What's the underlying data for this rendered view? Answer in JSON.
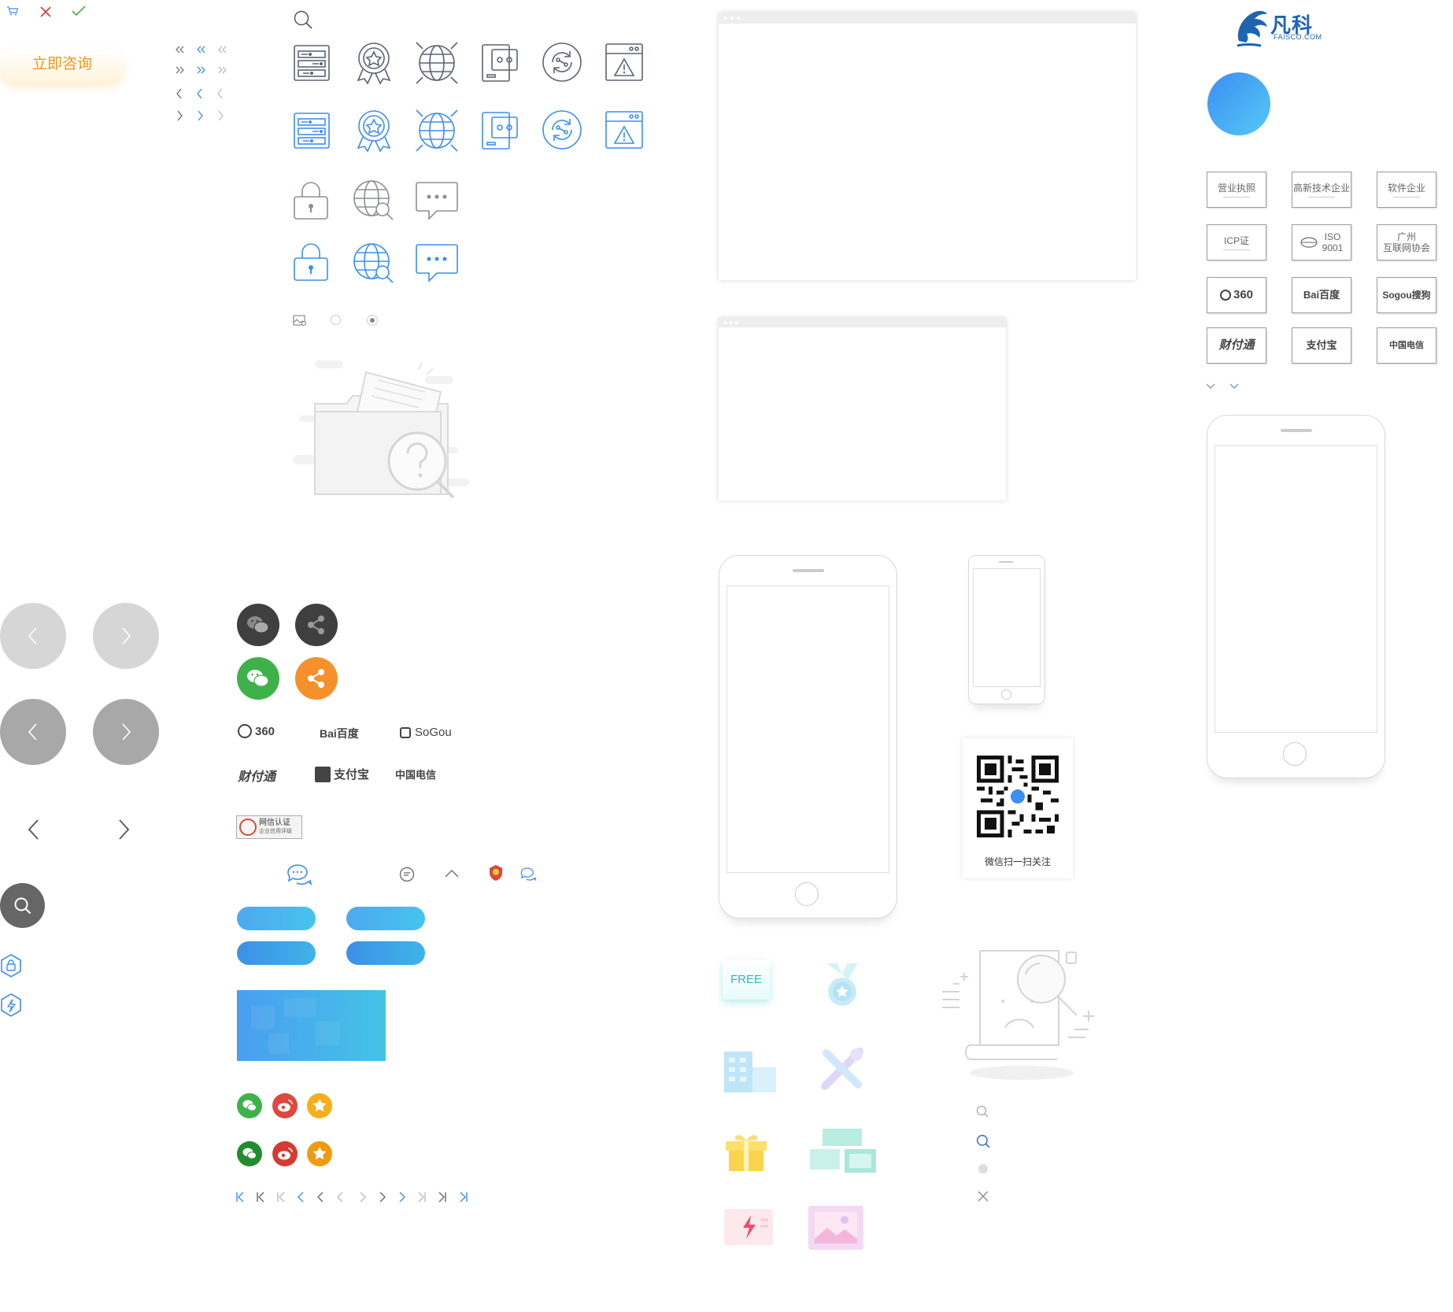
{
  "consult_button": {
    "label": "立即咨询"
  },
  "logo": {
    "name": "凡科",
    "domain": "FAISCO.COM"
  },
  "certs": [
    {
      "label": "营业执照"
    },
    {
      "label": "高新技术企业"
    },
    {
      "label": "软件企业"
    },
    {
      "label": "ICP证"
    },
    {
      "label": "ISO\n9001"
    },
    {
      "label": "广州\n互联网协会"
    }
  ],
  "cert_logos": [
    "360",
    "Bai百度",
    "Sogou搜狗",
    "财付通",
    "支付宝",
    "中国电信"
  ],
  "brand_logos": {
    "row1": [
      "360",
      "Bai百度",
      "SoGou"
    ],
    "row2": [
      "财付通",
      "支付宝",
      "中国电信"
    ]
  },
  "wangxin": {
    "title": "网信认证",
    "subtitle": "企业信用评级"
  },
  "qr": {
    "caption": "微信扫一扫关注"
  },
  "free_badge": "FREE",
  "colors": {
    "accent_blue": "#3c8ef2",
    "gray_icon": "#5b6372",
    "consult_orange": "#f3961f",
    "wechat_green": "#3fb14a",
    "share_orange": "#f6902c",
    "dark_circle": "#3f3f3f",
    "weibo_red": "#e0473f",
    "star_yellow": "#f6ae1b"
  },
  "icons": [
    "cart-icon",
    "close-icon",
    "check-icon",
    "search-icon",
    "double-left-icon",
    "double-right-icon",
    "chevron-left-icon",
    "chevron-right-icon",
    "list-icon",
    "award-icon",
    "globe-icon",
    "devices-icon",
    "sync-icon",
    "warning-window-icon",
    "lock-icon",
    "web-search-icon",
    "chat-icon",
    "image-icon",
    "radio-icon",
    "empty-folder-icon",
    "wechat-icon",
    "share-icon",
    "weibo-icon",
    "qq-star-icon",
    "shield-lock-icon",
    "shield-bolt-icon",
    "medal-icon",
    "building-icon",
    "tools-icon",
    "gift-icon",
    "layout-icon",
    "bolt-icon",
    "picture-icon",
    "no-result-icon",
    "page-first-icon",
    "page-last-icon"
  ]
}
